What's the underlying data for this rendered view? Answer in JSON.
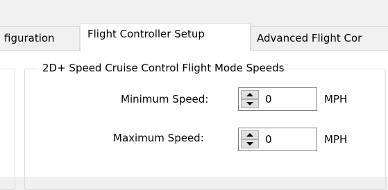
{
  "tabs": [
    {
      "label": "figuration"
    },
    {
      "label": "Flight Controller Setup"
    },
    {
      "label": "Advanced Flight Cor"
    }
  ],
  "group": {
    "title": "2D+ Speed Cruise Control Flight Mode Speeds"
  },
  "fields": [
    {
      "label": "Minimum Speed:",
      "value": "0",
      "unit": "MPH"
    },
    {
      "label": "Maximum Speed:",
      "value": "0",
      "unit": "MPH"
    }
  ],
  "icons": {
    "spin_up": "triangle-up-icon",
    "spin_down": "triangle-down-icon"
  },
  "colors": {
    "window_background": "#f0f0f0",
    "panel_background": "#ffffff",
    "border": "#d9d9d9"
  }
}
